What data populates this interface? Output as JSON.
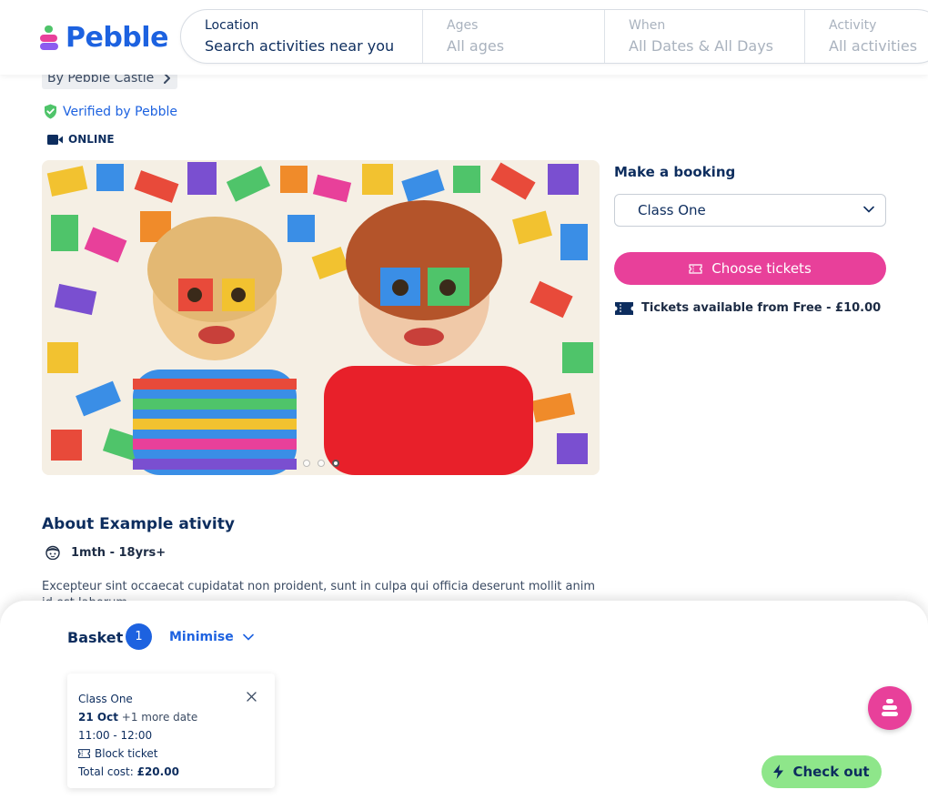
{
  "brand": {
    "name": "Pebble"
  },
  "search": {
    "location": {
      "label": "Location",
      "value": "Search activities near you"
    },
    "ages": {
      "label": "Ages",
      "value": "All ages"
    },
    "when": {
      "label": "When",
      "value": "All Dates & All Days"
    },
    "activity": {
      "label": "Activity",
      "value": "All activities"
    }
  },
  "provider": {
    "by": "By Pebble Castle",
    "verified": "Verified by Pebble",
    "mode": "ONLINE"
  },
  "gallery": {
    "slides": 3,
    "active_slide": 3,
    "image_icon": "photo-children-with-blocks"
  },
  "booking": {
    "title": "Make a booking",
    "selected_class": "Class One",
    "cta": "Choose tickets",
    "availability": "Tickets available from Free - £10.00"
  },
  "about": {
    "title": "About Example ativity",
    "age_range": "1mth - 18yrs+",
    "description": "Excepteur sint occaecat cupidatat non proident, sunt in culpa qui officia deserunt mollit anim id est laborum."
  },
  "basket": {
    "title": "Basket",
    "count": "1",
    "minimise": "Minimise",
    "item": {
      "name": "Class One",
      "date": "21 Oct",
      "more": "+1 more date",
      "time": "11:00 - 12:00",
      "ticket": "Block ticket",
      "cost_label": "Total cost:",
      "cost": "£20.00"
    },
    "checkout": "Check out"
  },
  "colors": {
    "brand_blue": "#1d62e0",
    "navy": "#0d2d5e",
    "pink": "#e8409a",
    "green": "#8ee68a",
    "verified_green": "#4fc46a"
  }
}
